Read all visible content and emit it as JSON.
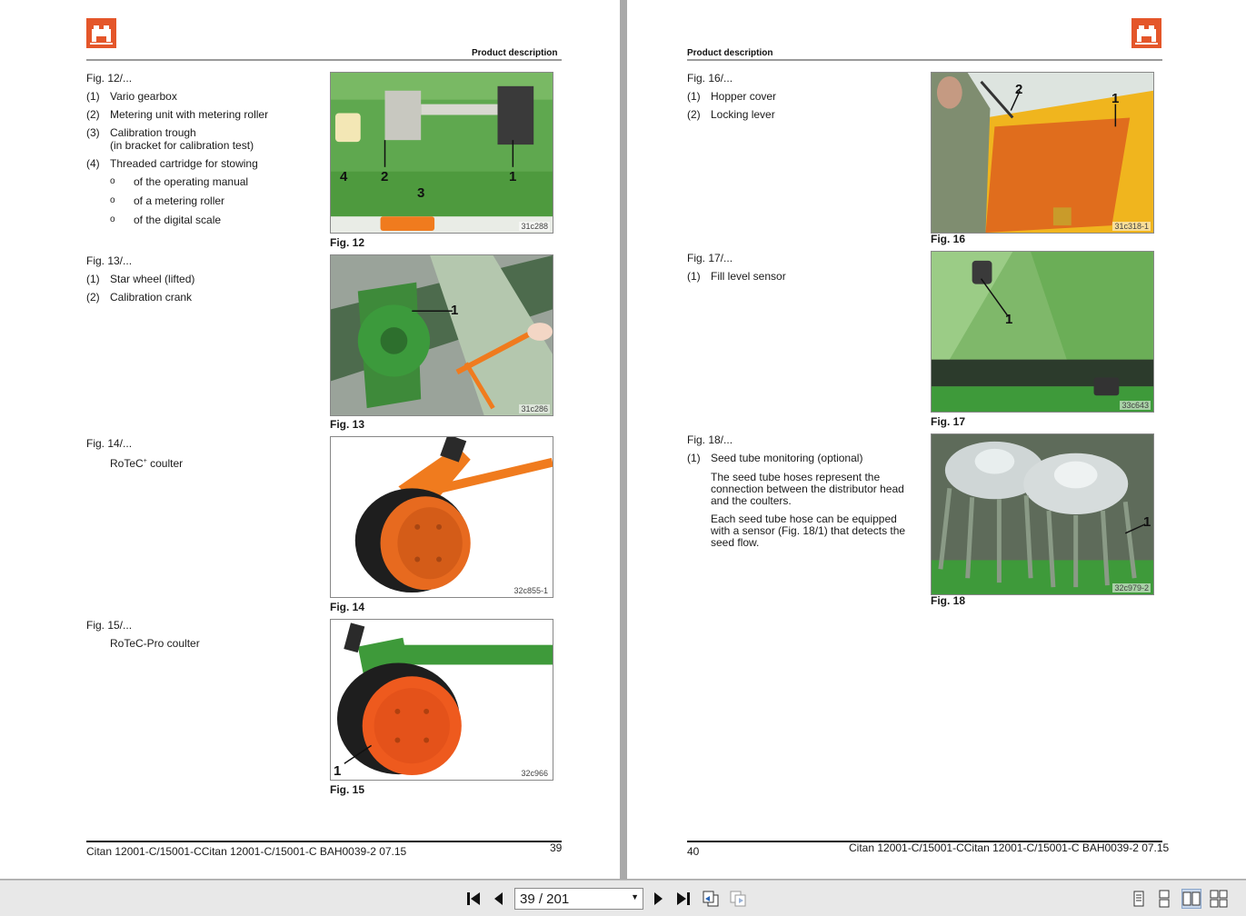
{
  "left_page": {
    "header": "Product description",
    "fig12": {
      "ref": "Fig. 12/...",
      "items": [
        {
          "num": "(1)",
          "text": "Vario gearbox"
        },
        {
          "num": "(2)",
          "text": "Metering unit with metering roller"
        },
        {
          "num": "(3)",
          "text": "Calibration trough",
          "text2": "(in bracket for calibration test)"
        },
        {
          "num": "(4)",
          "text": "Threaded cartridge for stowing"
        }
      ],
      "subs": [
        {
          "bullet": "o",
          "text": "of the operating manual"
        },
        {
          "bullet": "o",
          "text": "of a metering roller"
        },
        {
          "bullet": "o",
          "text": "of the digital scale"
        }
      ],
      "caption": "Fig. 12",
      "code": "31c288",
      "callouts": [
        "4",
        "2",
        "1",
        "3"
      ]
    },
    "fig13": {
      "ref": "Fig. 13/...",
      "items": [
        {
          "num": "(1)",
          "text": "Star wheel (lifted)"
        },
        {
          "num": "(2)",
          "text": "Calibration crank"
        }
      ],
      "caption": "Fig. 13",
      "code": "31c286",
      "callouts": [
        "1"
      ]
    },
    "fig14": {
      "ref": "Fig. 14/...",
      "text": "RoTeC",
      "sup": "+",
      "text_after": " coulter",
      "caption": "Fig. 14",
      "code": "32c855-1"
    },
    "fig15": {
      "ref": "Fig. 15/...",
      "text": "RoTeC-Pro coulter",
      "caption": "Fig. 15",
      "code": "32c966",
      "callouts": [
        "1"
      ]
    },
    "footer": {
      "doc": "Citan 12001-C/15001-CCitan 12001-C/15001-C  BAH0039-2  07.15",
      "page": "39"
    }
  },
  "right_page": {
    "header": "Product description",
    "fig16": {
      "ref": "Fig. 16/...",
      "items": [
        {
          "num": "(1)",
          "text": "Hopper cover"
        },
        {
          "num": "(2)",
          "text": "Locking lever"
        }
      ],
      "caption": "Fig. 16",
      "code": "31c318-1",
      "callouts": [
        "2",
        "1"
      ]
    },
    "fig17": {
      "ref": "Fig. 17/...",
      "items": [
        {
          "num": "(1)",
          "text": "Fill level sensor"
        }
      ],
      "caption": "Fig. 17",
      "code": "33c643",
      "callouts": [
        "1"
      ]
    },
    "fig18": {
      "ref": "Fig. 18/...",
      "items": [
        {
          "num": "(1)",
          "text": "Seed tube monitoring (optional)"
        }
      ],
      "paras": [
        "The seed tube hoses represent the connection between the distributor head and the coulters.",
        "Each seed tube hose can be equipped with a sensor (Fig. 18/1) that detects the seed flow."
      ],
      "caption": "Fig. 18",
      "code": "32c979-2",
      "callouts": [
        "1"
      ]
    },
    "footer": {
      "page": "40",
      "doc": "Citan 12001-C/15001-CCitan 12001-C/15001-C  BAH0039-2  07.15"
    }
  },
  "toolbar": {
    "page_indicator": "39 / 201",
    "icons": [
      "first-page-icon",
      "previous-page-icon",
      "next-page-icon",
      "last-page-icon",
      "go-back-icon",
      "go-forward-icon",
      "single-page-view-icon",
      "continuous-view-icon",
      "facing-pages-view-icon",
      "continuous-facing-view-icon"
    ]
  },
  "colors": {
    "brand_orange": "#e4562a",
    "machine_green": "#3e9a3a",
    "coulter_orange": "#f07b1e"
  }
}
